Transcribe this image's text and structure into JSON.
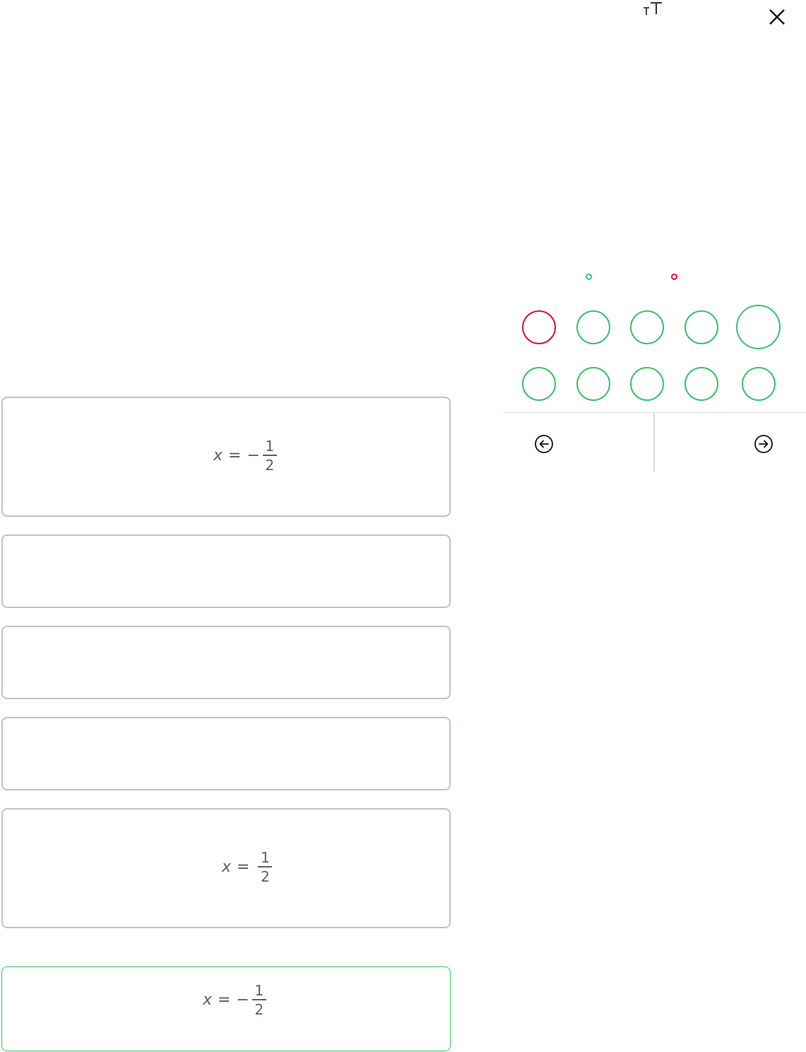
{
  "header": {
    "font_size_icon": "font-size-icon",
    "close_icon": "close-icon"
  },
  "legend": {
    "correct_color": "#2ecc71",
    "incorrect_color": "#d7153a"
  },
  "questions": [
    {
      "status": "incorrect"
    },
    {
      "status": "correct"
    },
    {
      "status": "correct"
    },
    {
      "status": "correct"
    },
    {
      "status": "correct",
      "current": true
    },
    {
      "status": "correct"
    },
    {
      "status": "correct"
    },
    {
      "status": "correct"
    },
    {
      "status": "correct"
    },
    {
      "status": "correct"
    }
  ],
  "nav": {
    "prev_icon": "arrow-left-circle-icon",
    "next_icon": "arrow-right-circle-icon"
  },
  "answers": [
    {
      "var": "x",
      "eq": "=",
      "sign": "−",
      "num": "1",
      "den": "2"
    },
    {
      "var": "",
      "eq": "",
      "sign": "",
      "num": "",
      "den": ""
    },
    {
      "var": "",
      "eq": "",
      "sign": "",
      "num": "",
      "den": ""
    },
    {
      "var": "",
      "eq": "",
      "sign": "",
      "num": "",
      "den": ""
    },
    {
      "var": "x",
      "eq": "=",
      "sign": "",
      "num": "1",
      "den": "2"
    }
  ],
  "correct_answer": {
    "var": "x",
    "eq": "=",
    "sign": "−",
    "num": "1",
    "den": "2"
  }
}
